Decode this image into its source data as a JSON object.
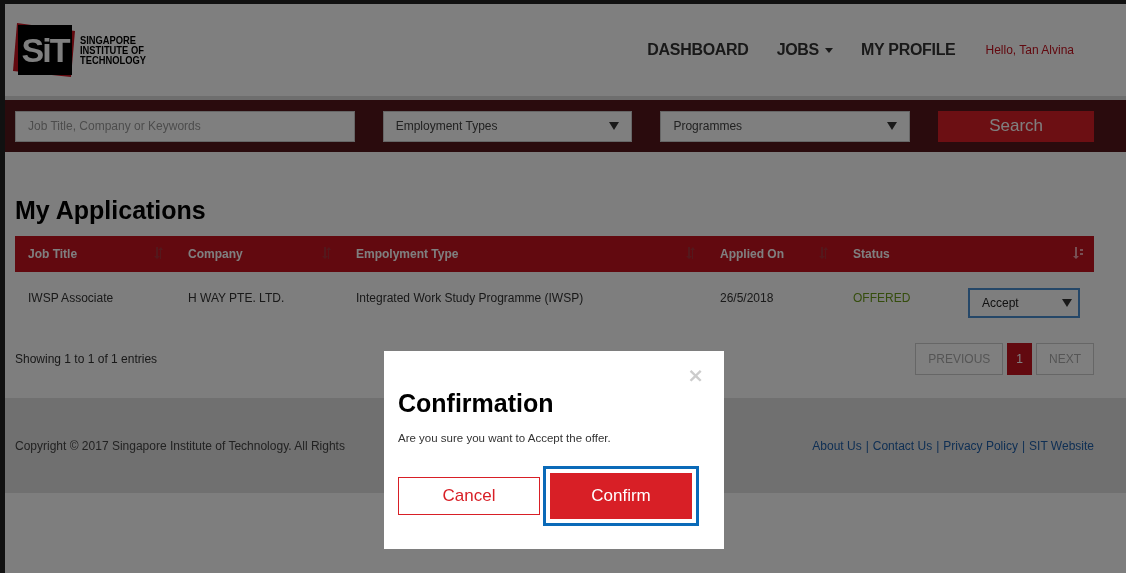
{
  "header": {
    "logo_mark": "SiT",
    "logo_lines": [
      "SINGAPORE",
      "INSTITUTE OF",
      "TECHNOLOGY"
    ],
    "nav": [
      {
        "label": "DASHBOARD",
        "kind": "link"
      },
      {
        "label": "JOBS",
        "kind": "dropdown"
      },
      {
        "label": "MY PROFILE",
        "kind": "link"
      }
    ],
    "greeting": "Hello, Tan Alvina"
  },
  "search_bar": {
    "keyword": {
      "placeholder": "Job Title, Company or Keywords"
    },
    "dropdowns": [
      "Employment Types",
      "Programmes"
    ],
    "button": "Search"
  },
  "page_title": "My Applications",
  "table": {
    "columns": [
      {
        "label": "Job Title",
        "sorted": false
      },
      {
        "label": "Company",
        "sorted": false
      },
      {
        "label": "Empolyment Type",
        "sorted": false
      },
      {
        "label": "Applied On",
        "sorted": false
      },
      {
        "label": "Status",
        "sorted": true
      }
    ],
    "rows": [
      {
        "cells": [
          "IWSP Associate",
          "H WAY PTE. LTD.",
          "Integrated Work Study Programme (IWSP)",
          "26/5/2018"
        ],
        "status": "OFFERED",
        "action": "Accept"
      }
    ]
  },
  "info": "Showing 1 to 1 of 1 entries",
  "pagination": [
    {
      "label": "PREVIOUS",
      "kind": "nav",
      "selected": false
    },
    {
      "label": "1",
      "kind": "page",
      "selected": true
    },
    {
      "label": "NEXT",
      "kind": "nav",
      "selected": false
    }
  ],
  "footer": {
    "copyright": "Copyright © 2017 Singapore Institute of Technology. All Rights",
    "separator": "|",
    "links": [
      "About Us",
      "Contact Us",
      "Privacy Policy",
      "SIT Website"
    ]
  },
  "modal": {
    "title": "Confirmation",
    "message": "Are you sure you want to Accept the offer.",
    "close": "×",
    "buttons": [
      {
        "label": "Cancel",
        "kind": "secondary",
        "focused": false
      },
      {
        "label": "Confirm",
        "kind": "primary",
        "focused": true
      }
    ]
  }
}
